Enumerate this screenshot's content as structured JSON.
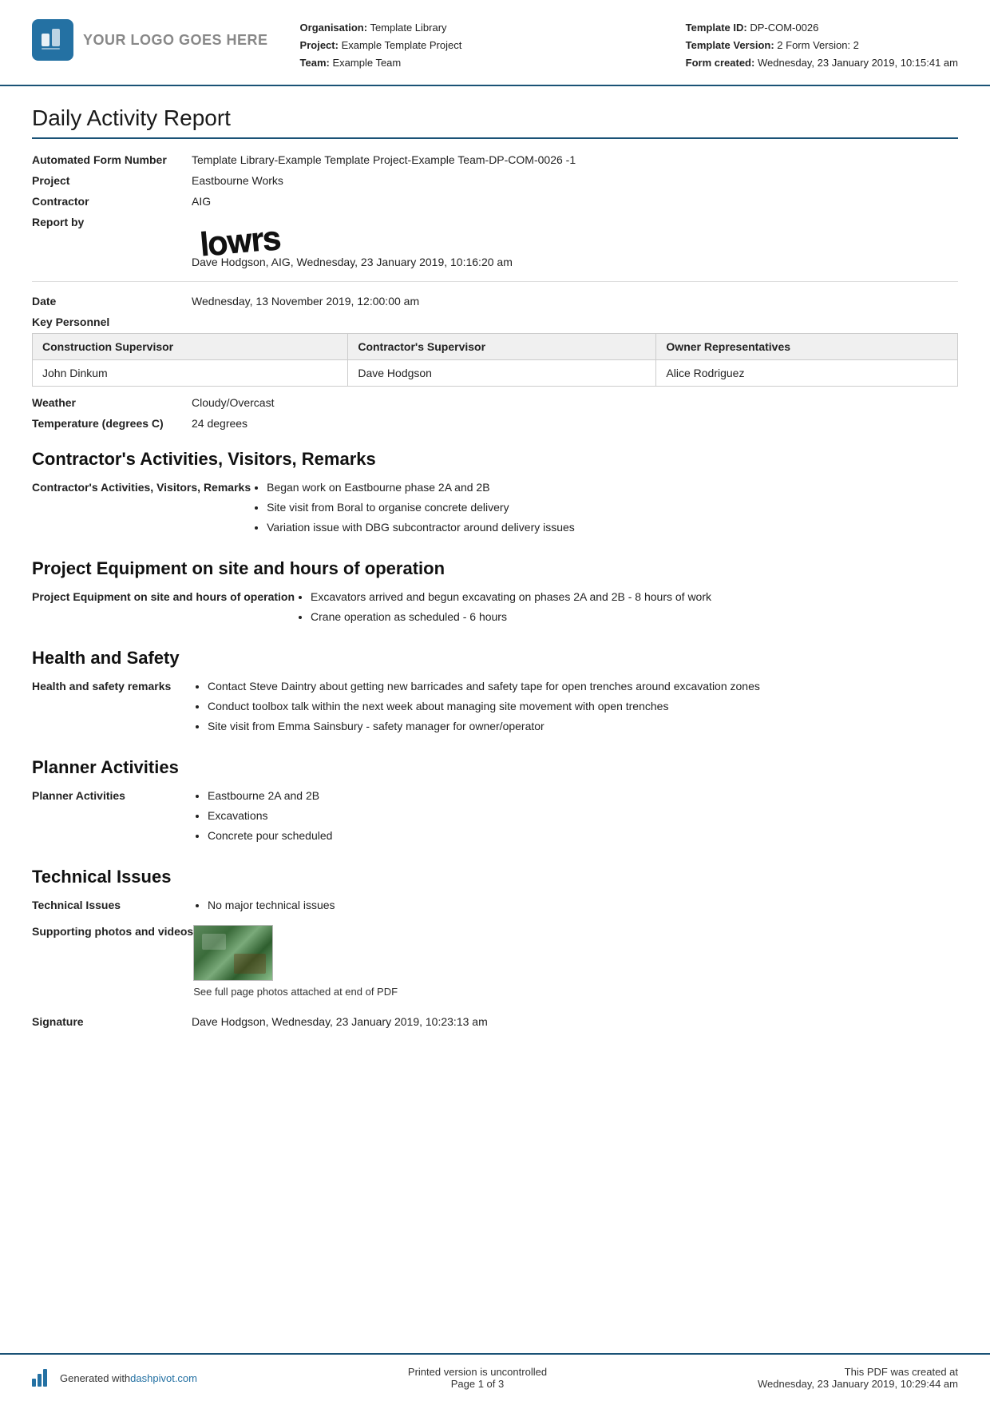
{
  "header": {
    "logo_text": "YOUR LOGO GOES HERE",
    "org_label": "Organisation:",
    "org_value": "Template Library",
    "project_label": "Project:",
    "project_value": "Example Template Project",
    "team_label": "Team:",
    "team_value": "Example Team",
    "template_id_label": "Template ID:",
    "template_id_value": "DP-COM-0026",
    "template_version_label": "Template Version:",
    "template_version_value": "2 Form Version: 2",
    "form_created_label": "Form created:",
    "form_created_value": "Wednesday, 23 January 2019, 10:15:41 am"
  },
  "report": {
    "title": "Daily Activity Report",
    "automated_form_label": "Automated Form Number",
    "automated_form_value": "Template Library-Example Template Project-Example Team-DP-COM-0026   -1",
    "project_label": "Project",
    "project_value": "Eastbourne Works",
    "contractor_label": "Contractor",
    "contractor_value": "AIG",
    "report_by_label": "Report by",
    "report_by_value": "Dave Hodgson, AIG, Wednesday, 23 January 2019, 10:16:20 am",
    "date_label": "Date",
    "date_value": "Wednesday, 13 November 2019, 12:00:00 am",
    "key_personnel_label": "Key Personnel",
    "weather_label": "Weather",
    "weather_value": "Cloudy/Overcast",
    "temperature_label": "Temperature (degrees C)",
    "temperature_value": "24 degrees"
  },
  "personnel_table": {
    "col1_header": "Construction Supervisor",
    "col2_header": "Contractor's Supervisor",
    "col3_header": "Owner Representatives",
    "row1_col1": "John Dinkum",
    "row1_col2": "Dave Hodgson",
    "row1_col3": "Alice Rodriguez"
  },
  "contractors_activities": {
    "section_title": "Contractor's Activities, Visitors, Remarks",
    "field_label": "Contractor's Activities, Visitors, Remarks",
    "bullets": [
      "Began work on Eastbourne phase 2A and 2B",
      "Site visit from Boral to organise concrete delivery",
      "Variation issue with DBG subcontractor around delivery issues"
    ]
  },
  "equipment": {
    "section_title": "Project Equipment on site and hours of operation",
    "field_label": "Project Equipment on site and hours of operation",
    "bullets": [
      "Excavators arrived and begun excavating on phases 2A and 2B - 8 hours of work",
      "Crane operation as scheduled - 6 hours"
    ]
  },
  "health_safety": {
    "section_title": "Health and Safety",
    "field_label": "Health and safety remarks",
    "bullets": [
      "Contact Steve Daintry about getting new barricades and safety tape for open trenches around excavation zones",
      "Conduct toolbox talk within the next week about managing site movement with open trenches",
      "Site visit from Emma Sainsbury - safety manager for owner/operator"
    ]
  },
  "planner": {
    "section_title": "Planner Activities",
    "field_label": "Planner Activities",
    "bullets": [
      "Eastbourne 2A and 2B",
      "Excavations",
      "Concrete pour scheduled"
    ]
  },
  "technical_issues": {
    "section_title": "Technical Issues",
    "field_label": "Technical Issues",
    "bullets": [
      "No major technical issues"
    ],
    "photos_label": "Supporting photos and videos",
    "photo_caption": "See full page photos attached at end of PDF",
    "signature_label": "Signature",
    "signature_value": "Dave Hodgson, Wednesday, 23 January 2019, 10:23:13 am"
  },
  "footer": {
    "generated_text": "Generated with ",
    "dashpivot_link": "dashpivot.com",
    "uncontrolled_text": "Printed version is uncontrolled",
    "page_text": "Page 1 of 3",
    "pdf_created_text": "This PDF was created at",
    "pdf_created_date": "Wednesday, 23 January 2019, 10:29:44 am"
  }
}
